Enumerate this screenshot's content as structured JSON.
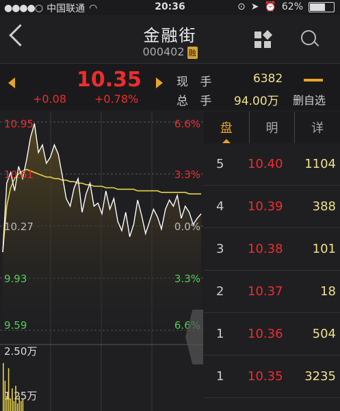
{
  "status_bar": {
    "carrier": "中国联通",
    "time": "20:36",
    "battery": "62%"
  },
  "header": {
    "title": "金融街",
    "code": "000402",
    "badge": "融"
  },
  "quote": {
    "price": "10.35",
    "change": "+0.08",
    "change_pct": "+0.78%",
    "current_hand_label": "现 手",
    "current_hand": "6382",
    "total_hand_label": "总 手",
    "total_hand": "94.00万",
    "watchlist_remove": "删自选"
  },
  "chart_data": {
    "type": "line",
    "price_axis": [
      "10.95",
      "10.61",
      "10.27",
      "9.93",
      "9.59"
    ],
    "pct_axis": [
      "6.6%",
      "3.3%",
      "0.0%",
      "3.3%",
      "6.6%"
    ],
    "volume_axis": [
      "2.50万",
      "1.25万"
    ],
    "ylim": [
      9.59,
      10.95
    ],
    "series": [
      {
        "values": [
          10.1,
          10.55,
          10.62,
          10.5,
          10.66,
          10.58,
          10.7,
          10.85,
          10.94,
          10.75,
          10.8,
          10.68,
          10.72,
          10.8,
          10.74,
          10.6,
          10.45,
          10.4,
          10.52,
          10.58,
          10.36,
          10.48,
          10.55,
          10.4,
          10.42,
          10.35,
          10.5,
          10.38,
          10.45,
          10.3,
          10.24,
          10.36,
          10.2,
          10.28,
          10.44,
          10.34,
          10.22,
          10.3,
          10.38,
          10.33,
          10.25,
          10.38,
          10.44,
          10.4,
          10.47,
          10.32,
          10.4,
          10.36,
          10.28,
          10.32,
          10.35
        ]
      },
      {
        "values": [
          10.1,
          10.4,
          10.52,
          10.58,
          10.61,
          10.63,
          10.64,
          10.63,
          10.62,
          10.61,
          10.6,
          10.59,
          10.59,
          10.58,
          10.58,
          10.57,
          10.57,
          10.56,
          10.56,
          10.55,
          10.55,
          10.54,
          10.54,
          10.53,
          10.53,
          10.53,
          10.52,
          10.52,
          10.52,
          10.51,
          10.51,
          10.51,
          10.51,
          10.51,
          10.5,
          10.5,
          10.5,
          10.5,
          10.5,
          10.5,
          10.49,
          10.49,
          10.49,
          10.49,
          10.49,
          10.49,
          10.49,
          10.48,
          10.48,
          10.48,
          10.48
        ]
      }
    ],
    "volume": [
      1.9,
      1.2,
      0.6,
      1.7,
      0.5,
      0.9,
      0.4,
      1.0,
      0.3,
      0.6,
      0.4,
      0.5
    ]
  },
  "tabs": [
    "盘",
    "明",
    "详"
  ],
  "order_book": [
    {
      "level": "5",
      "price": "10.40",
      "volume": "1104"
    },
    {
      "level": "4",
      "price": "10.39",
      "volume": "388"
    },
    {
      "level": "3",
      "price": "10.38",
      "volume": "101"
    },
    {
      "level": "2",
      "price": "10.37",
      "volume": "18"
    },
    {
      "level": "1",
      "price": "10.36",
      "volume": "504"
    },
    {
      "level": "1",
      "price": "10.35",
      "volume": "3235"
    }
  ],
  "colors": {
    "up": "#ee2d2d",
    "down": "#55cc55",
    "accent": "#e8a32a",
    "price_line": "#ffffff",
    "avg_line": "#e6d24a"
  }
}
